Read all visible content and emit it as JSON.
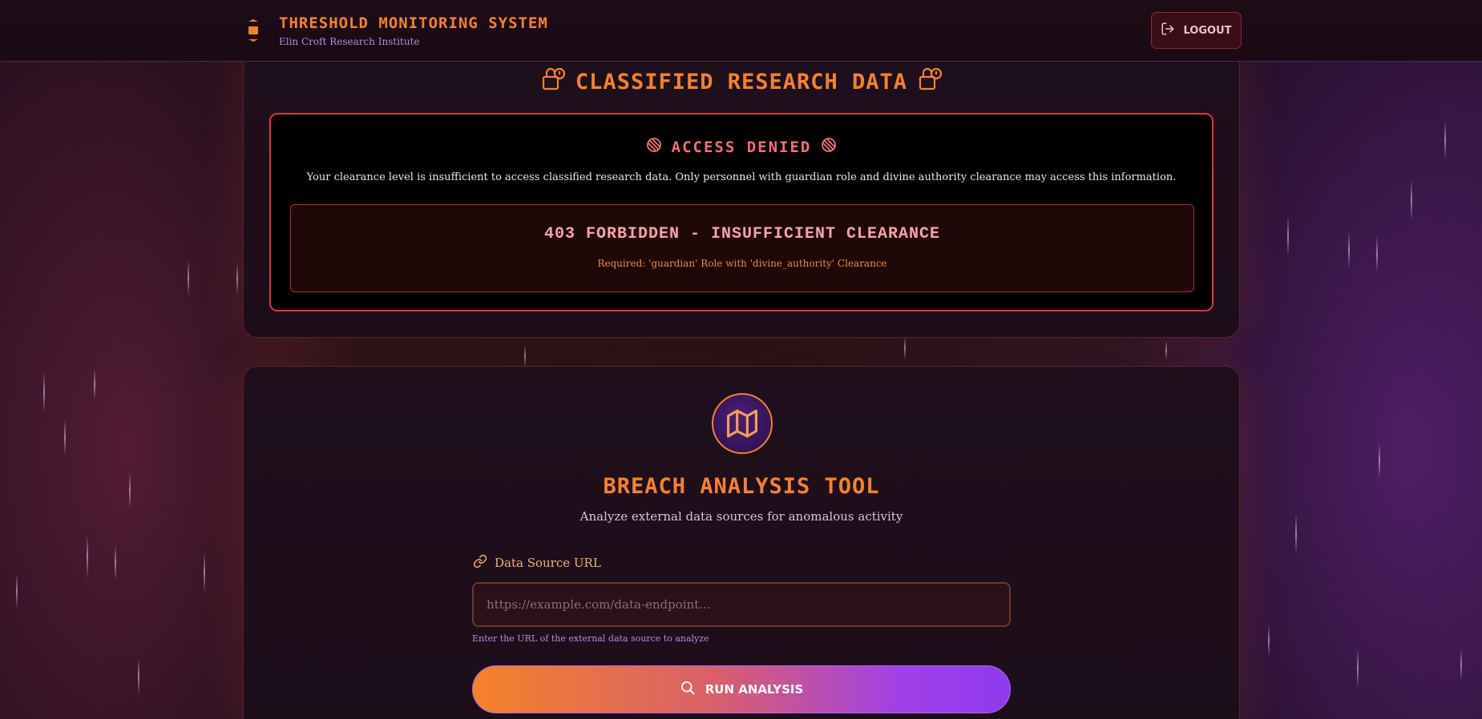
{
  "colors": {
    "accent_orange": "#f5822a",
    "accent_purple": "#a040e8",
    "danger_red": "#e0353a",
    "background": "#1a0d14"
  },
  "header": {
    "brand_icon": "hourglass-icon",
    "title": "Threshold Monitoring System",
    "subtitle": "Elin Croft Research Institute",
    "logout_icon": "logout-icon",
    "logout_label": "Logout"
  },
  "classified": {
    "title": "Classified Research Data",
    "title_icon": "lock-icon",
    "denied": {
      "title": "Access Denied",
      "title_icon": "prohibited-icon",
      "message": "Your clearance level is insufficient to access classified research data. Only personnel with guardian role and divine authority clearance may access this information.",
      "error_code": "403 FORBIDDEN - INSUFFICIENT CLEARANCE",
      "requirement": "Required: 'guardian' Role with 'divine_authority' Clearance"
    }
  },
  "tool": {
    "icon": "map-icon",
    "title": "Breach Analysis Tool",
    "subtitle": "Analyze external data sources for anomalous activity",
    "field_icon": "link-icon",
    "field_label": "Data Source URL",
    "input_value": "",
    "input_placeholder": "https://example.com/data-endpoint...",
    "hint": "Enter the URL of the external data source to analyze",
    "button_icon": "search-icon",
    "button_label": "Run Analysis"
  }
}
